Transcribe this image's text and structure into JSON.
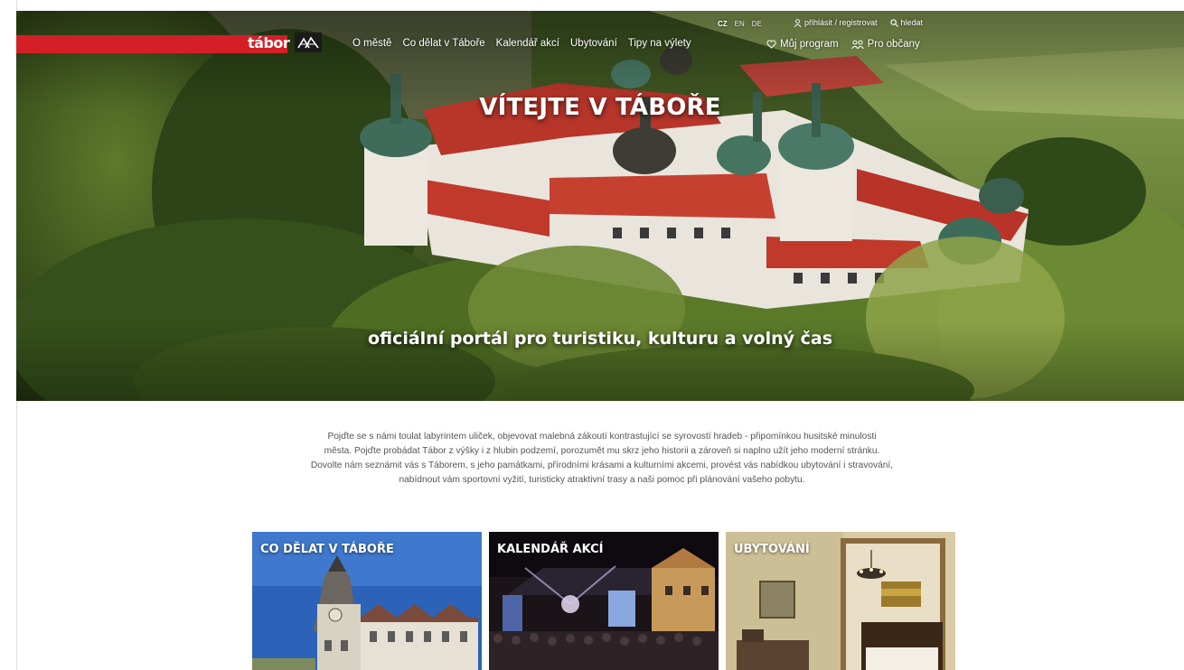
{
  "header": {
    "logo_text": "tábor",
    "nav": [
      "O městě",
      "Co dělat v Táboře",
      "Kalendář akcí",
      "Ubytování",
      "Tipy na výlety"
    ],
    "languages": [
      "CZ",
      "EN",
      "DE"
    ],
    "active_language": "CZ",
    "login_label": "přihlásit / registrovat",
    "search_label": "hledat",
    "my_program_label": "Můj program",
    "citizens_label": "Pro občany"
  },
  "hero": {
    "title": "VÍTEJTE V TÁBOŘE",
    "subtitle": "oficiální portál pro turistiku, kulturu a volný čas"
  },
  "intro": {
    "lines": [
      "Pojďte se s námi toulat labyrintem uliček, objevovat malebná zákoutí kontrastující se syrovostí hradeb - připomínkou husitské minulosti",
      "města. Pojďte probádat Tábor z výšky i z hlubin podzemí, porozumět mu skrz jeho historii a zároveň si naplno užít jeho moderní stránku.",
      "Dovolte nám seznámit vás s Táborem, s jeho památkami, přírodními krásami a kulturními akcemi, provést vás nabídkou ubytování i stravování,",
      "nabídnout vám sportovní vyžití, turisticky atraktivní trasy a naši pomoc při plánování vašeho pobytu."
    ]
  },
  "tiles": [
    {
      "title": "CO DĚLAT V TÁBOŘE"
    },
    {
      "title": "KALENDÁŘ AKCÍ"
    },
    {
      "title": "UBYTOVÁNÍ"
    }
  ],
  "colors": {
    "brand_red": "#d41f26"
  }
}
